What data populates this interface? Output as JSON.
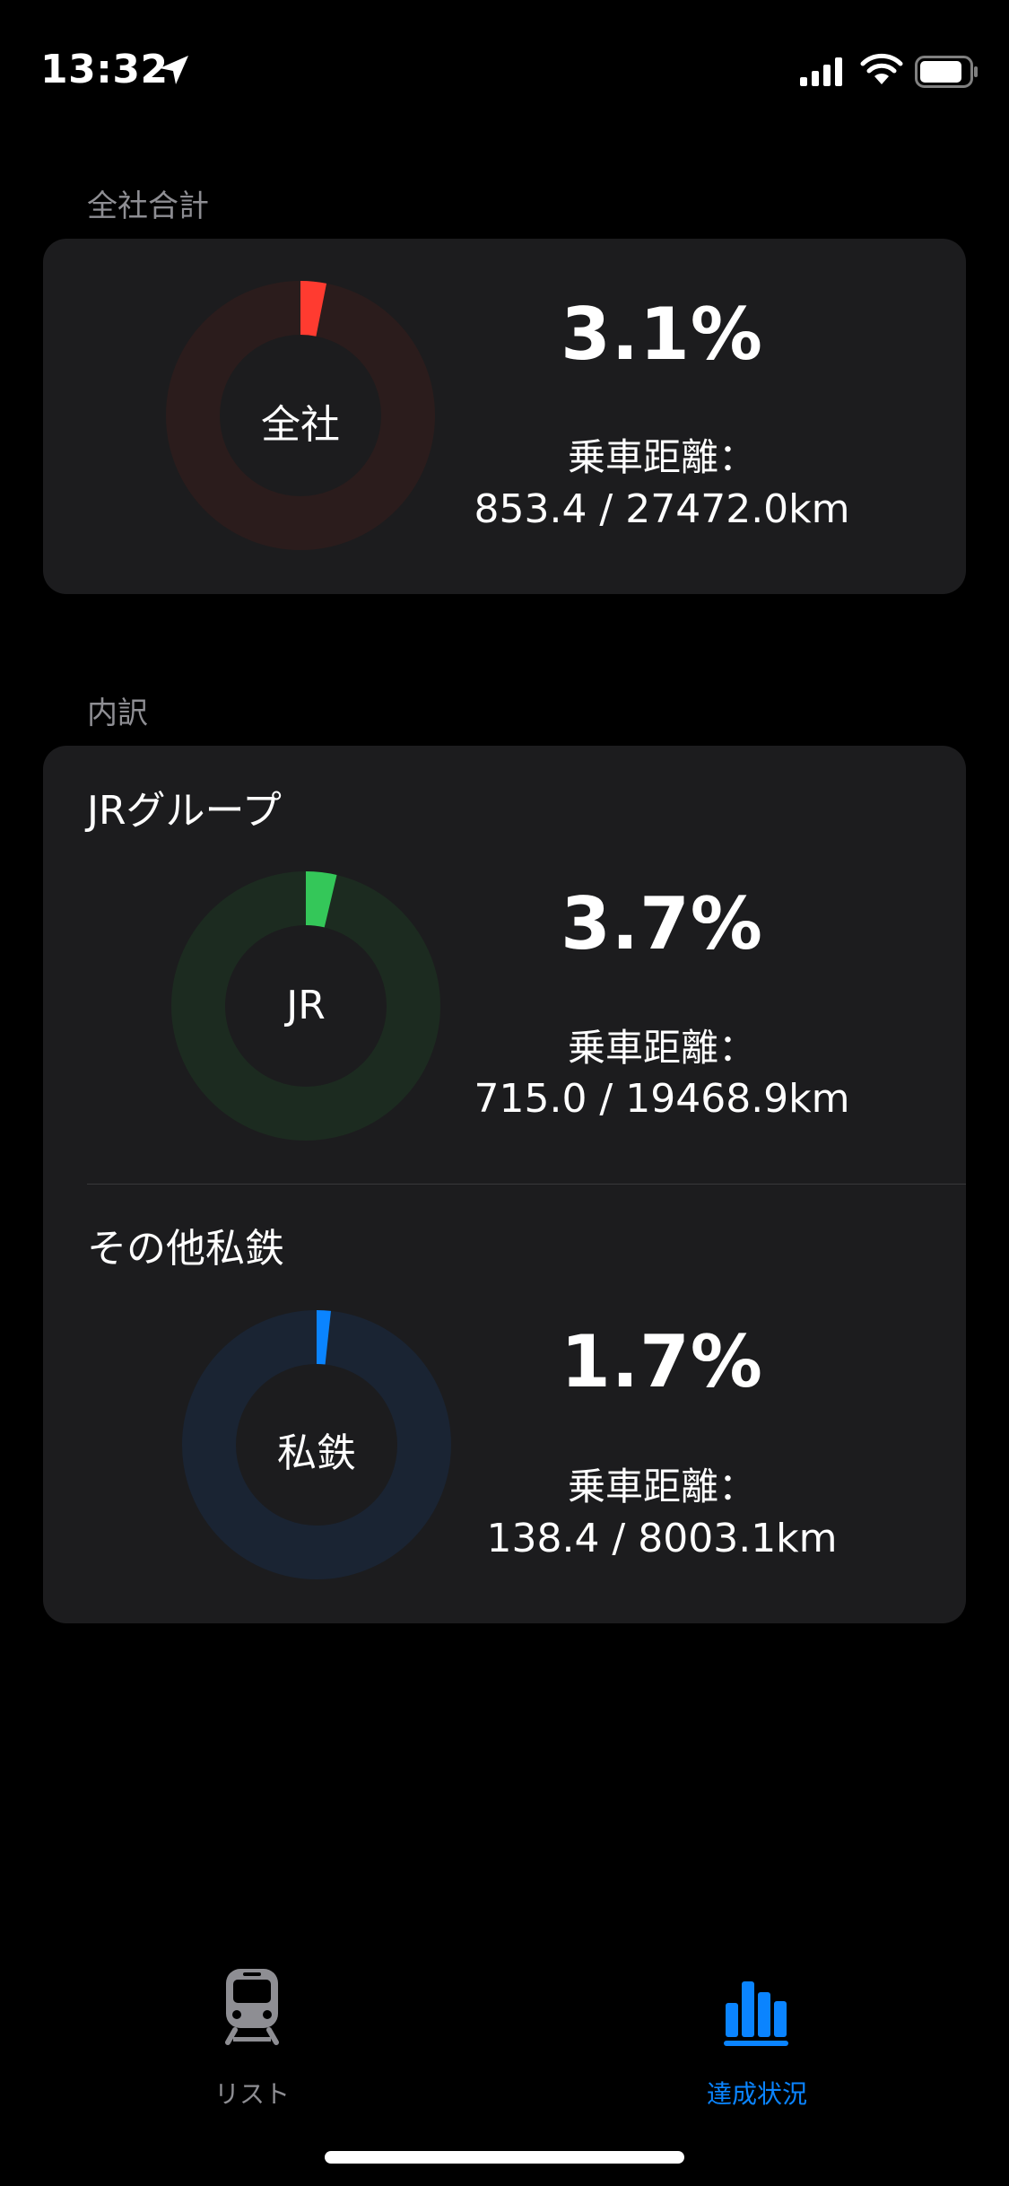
{
  "status_bar": {
    "time": "13:32"
  },
  "total_section": {
    "header": "全社合計",
    "ring_label": "全社",
    "percent": "3.1%",
    "fraction": 0.031,
    "distance_label": "乗車距離：",
    "distance_value": "853.4 / 27472.0km",
    "color": "#ff3b30",
    "track_color": "#2b1c1c"
  },
  "breakdown_section": {
    "header": "内訳",
    "groups": [
      {
        "title": "JRグループ",
        "ring_label": "JR",
        "percent": "3.7%",
        "fraction": 0.037,
        "distance_label": "乗車距離：",
        "distance_value": "715.0 / 19468.9km",
        "color": "#34c759",
        "track_color": "#1c2b20"
      },
      {
        "title": "その他私鉄",
        "ring_label": "私鉄",
        "percent": "1.7%",
        "fraction": 0.017,
        "distance_label": "乗車距離：",
        "distance_value": "138.4 / 8003.1km",
        "color": "#0a84ff",
        "track_color": "#1a2433"
      }
    ]
  },
  "tab_bar": {
    "tabs": [
      {
        "label": "リスト",
        "icon": "train-icon",
        "selected": false,
        "color": "#8e8e93"
      },
      {
        "label": "達成状況",
        "icon": "chart-bar-icon",
        "selected": true,
        "color": "#0a84ff"
      }
    ]
  }
}
